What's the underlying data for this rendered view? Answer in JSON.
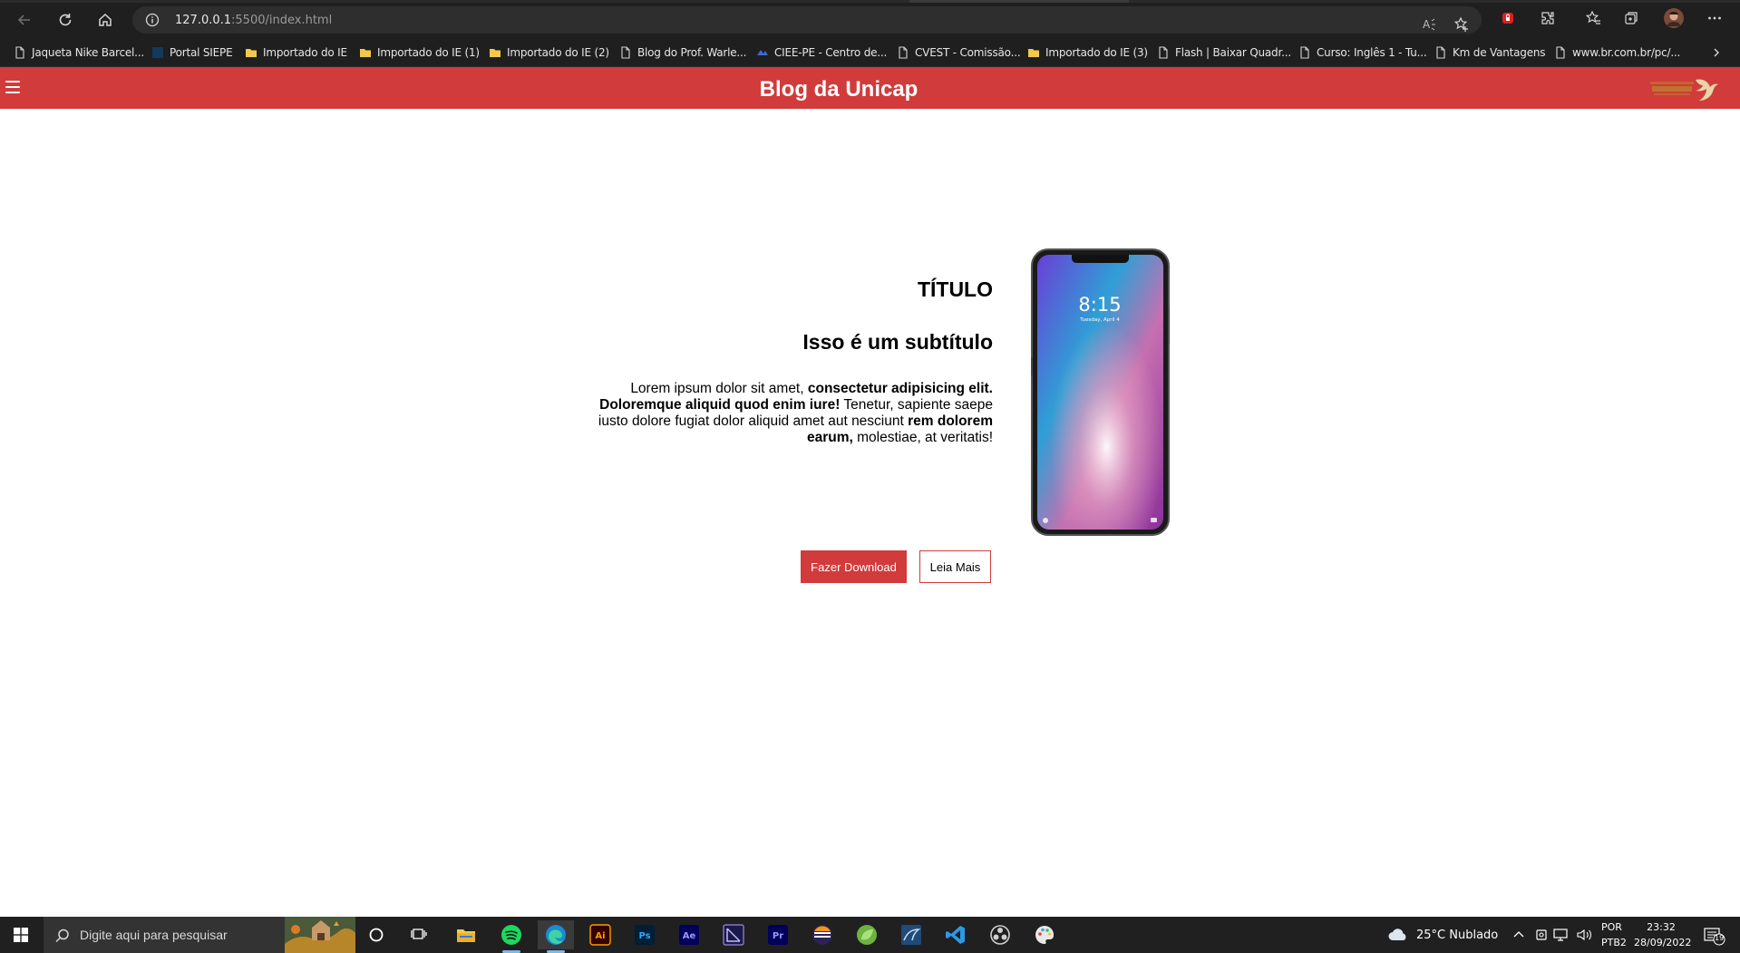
{
  "browser": {
    "url_host": "127.0.0.1",
    "url_rest": ":5500/index.html"
  },
  "bookmarks": [
    {
      "label": "Jaqueta Nike Barcel...",
      "icon": "page-icon"
    },
    {
      "label": "Portal SIEPE",
      "icon": "site-icon"
    },
    {
      "label": "Importado do IE",
      "icon": "folder-icon"
    },
    {
      "label": "Importado do IE (1)",
      "icon": "folder-icon"
    },
    {
      "label": "Importado do IE (2)",
      "icon": "folder-icon"
    },
    {
      "label": "Blog do Prof. Warle...",
      "icon": "page-icon"
    },
    {
      "label": "CIEE-PE - Centro de...",
      "icon": "site-icon"
    },
    {
      "label": "CVEST - Comissão...",
      "icon": "page-icon"
    },
    {
      "label": "Importado do IE (3)",
      "icon": "folder-icon"
    },
    {
      "label": "Flash | Baixar Quadr...",
      "icon": "page-icon"
    },
    {
      "label": "Curso: Inglês 1 - Tu...",
      "icon": "page-icon"
    },
    {
      "label": "Km de Vantagens",
      "icon": "page-icon"
    },
    {
      "label": "www.br.com.br/pc/...",
      "icon": "page-icon"
    }
  ],
  "site": {
    "title": "Blog da Unicap",
    "accent_color": "#d13b3b"
  },
  "hero": {
    "title": "TÍTULO",
    "subtitle": "Isso é um subtítulo",
    "body": {
      "p1": "Lorem ipsum dolor sit amet, ",
      "b1": "consectetur adipisicing elit. Doloremque aliquid quod enim iure!",
      "p2": " Tenetur, sapiente saepe iusto dolore fugiat dolor aliquid amet aut nesciunt ",
      "b2": "rem dolorem earum,",
      "p3": " molestiae, at veritatis!"
    },
    "phone_time": "8:15",
    "phone_date": "Tuesday, April 4"
  },
  "buttons": {
    "download": "Fazer Download",
    "read_more": "Leia Mais"
  },
  "taskbar": {
    "search_placeholder": "Digite aqui para pesquisar",
    "weather": "25°C  Nublado",
    "lang_top": "POR",
    "lang_bottom": "PTB2",
    "time": "23:32",
    "date": "28/09/2022",
    "notifications": "19"
  }
}
